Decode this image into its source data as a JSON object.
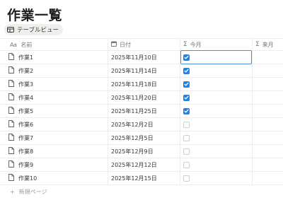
{
  "page": {
    "title": "作業一覧"
  },
  "view": {
    "label": "テーブルビュー",
    "icon": "table-icon"
  },
  "columns": {
    "name": {
      "label": "名前",
      "icon": "text-property-icon",
      "icon_text": "Aa"
    },
    "date": {
      "label": "日付",
      "icon": "calendar-icon"
    },
    "current": {
      "label": "今月",
      "icon": "formula-icon",
      "icon_text": "Σ"
    },
    "next": {
      "label": "来月",
      "icon": "formula-icon",
      "icon_text": "Σ"
    }
  },
  "rows": [
    {
      "name": "作業1",
      "date": "2025年11月10日",
      "current": true
    },
    {
      "name": "作業2",
      "date": "2025年11月14日",
      "current": true
    },
    {
      "name": "作業3",
      "date": "2025年11月18日",
      "current": true
    },
    {
      "name": "作業4",
      "date": "2025年11月20日",
      "current": true
    },
    {
      "name": "作業5",
      "date": "2025年11月25日",
      "current": true
    },
    {
      "name": "作業6",
      "date": "2025年12月2日",
      "current": false
    },
    {
      "name": "作業7",
      "date": "2025年12月5日",
      "current": false
    },
    {
      "name": "作業8",
      "date": "2025年12月9日",
      "current": false
    },
    {
      "name": "作業9",
      "date": "2025年12月12日",
      "current": false
    },
    {
      "name": "作業10",
      "date": "2025年12月15日",
      "current": false
    }
  ],
  "new_page": {
    "label": "新規ページ",
    "icon": "plus-icon",
    "icon_text": "+"
  },
  "colors": {
    "accent": "#2383e2",
    "selection": "#4a90d9"
  }
}
